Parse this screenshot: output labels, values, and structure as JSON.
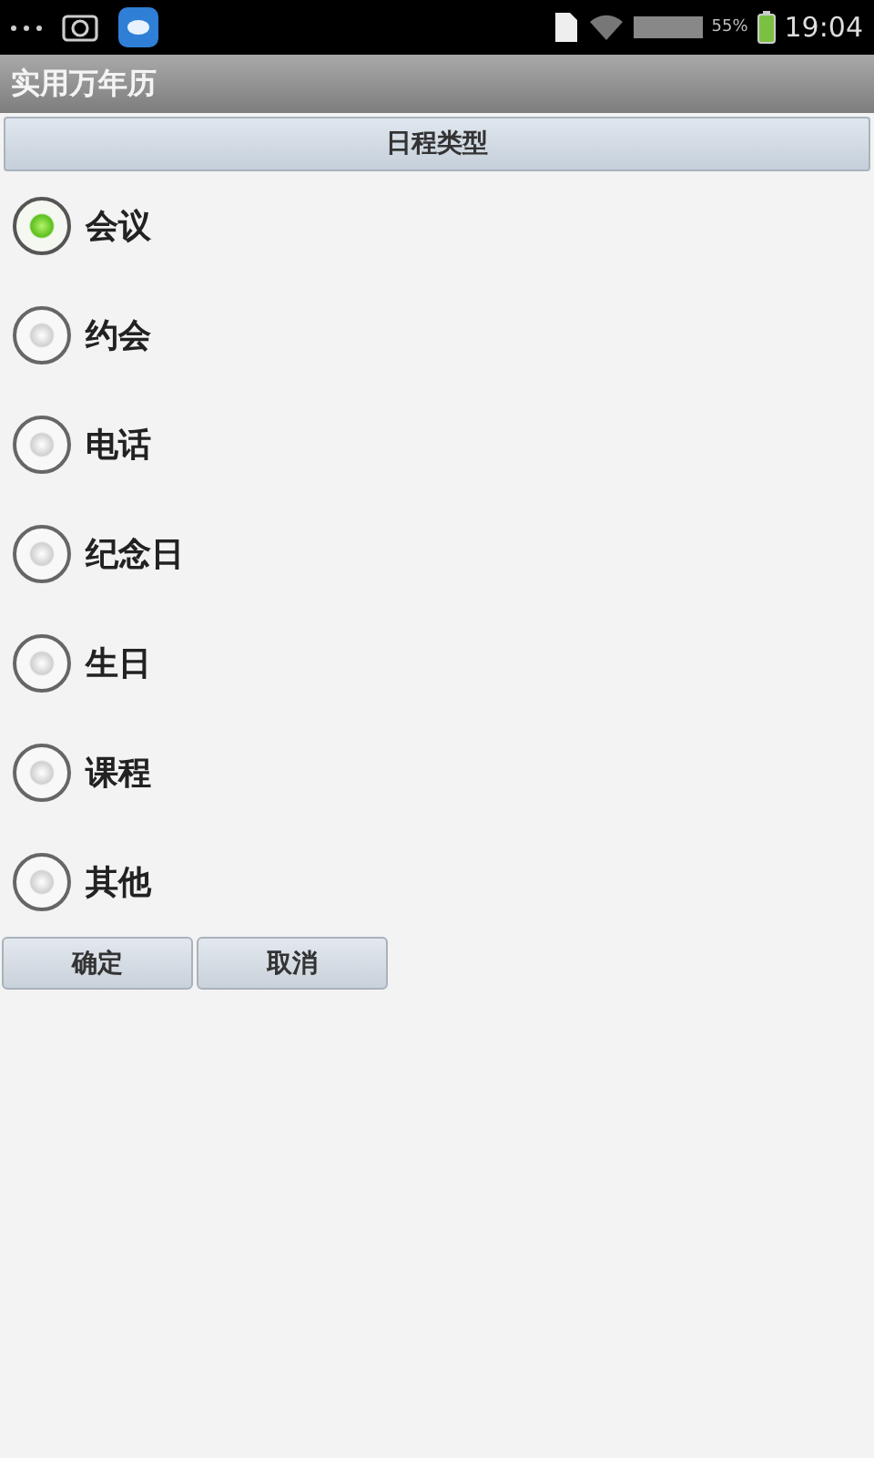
{
  "status_bar": {
    "battery_percent": "55%",
    "time": "19:04"
  },
  "app_title": "实用万年历",
  "dialog": {
    "title": "日程类型",
    "options": [
      {
        "label": "会议",
        "selected": true
      },
      {
        "label": "约会",
        "selected": false
      },
      {
        "label": "电话",
        "selected": false
      },
      {
        "label": "纪念日",
        "selected": false
      },
      {
        "label": "生日",
        "selected": false
      },
      {
        "label": "课程",
        "selected": false
      },
      {
        "label": "其他",
        "selected": false
      }
    ],
    "buttons": [
      "确定",
      "取消"
    ]
  }
}
